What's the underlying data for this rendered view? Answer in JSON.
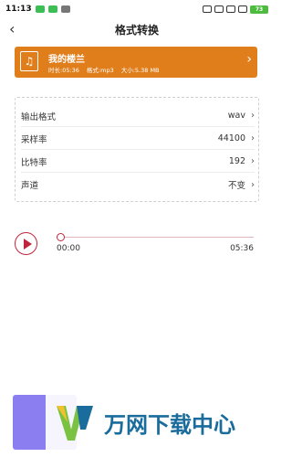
{
  "status": {
    "time": "11:13",
    "battery": "73"
  },
  "header": {
    "back_icon": "‹",
    "title": "格式转换"
  },
  "file": {
    "name": "我的楼兰",
    "duration": "时长:05:36",
    "format": "格式:mp3",
    "size": "大小:5.38 MB"
  },
  "settings": [
    {
      "label": "输出格式",
      "value": "wav"
    },
    {
      "label": "采样率",
      "value": "44100"
    },
    {
      "label": "比特率",
      "value": "192"
    },
    {
      "label": "声道",
      "value": "不变"
    }
  ],
  "player": {
    "current_time": "00:00",
    "total_time": "05:36",
    "progress": 0
  },
  "watermark": {
    "text": "万网下载中心"
  },
  "colors": {
    "accent_orange": "#e07e1c",
    "player_red": "#c0253d",
    "button_purple": "#8a7ef0"
  }
}
